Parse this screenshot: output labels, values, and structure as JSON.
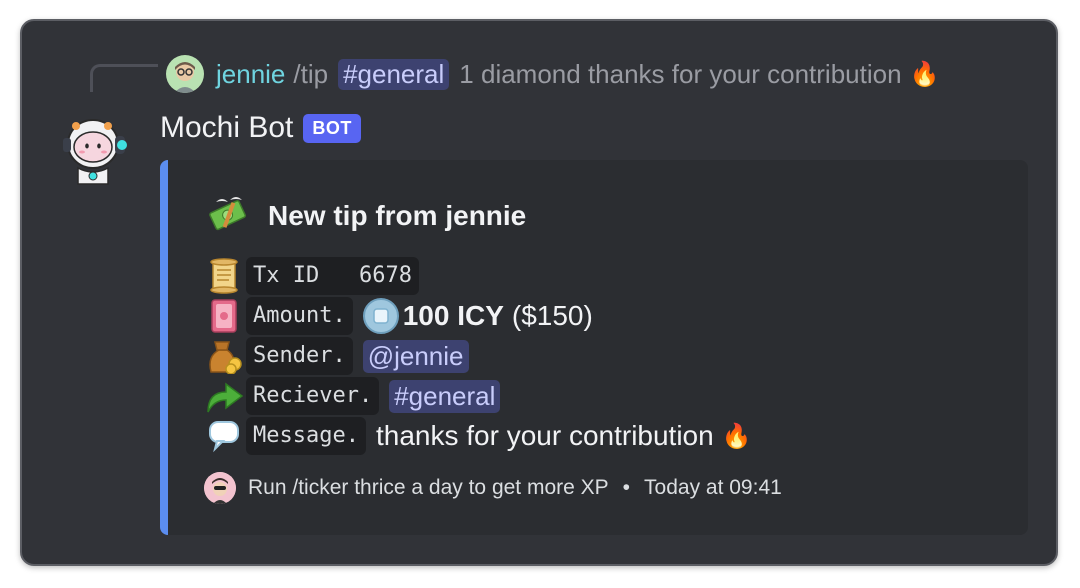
{
  "reply": {
    "username": "jennie",
    "command": "/tip",
    "channel": "#general",
    "text": "1 diamond thanks for your contribution",
    "emoji": "🔥"
  },
  "message": {
    "bot_name": "Mochi Bot",
    "bot_tag": "BOT"
  },
  "embed": {
    "accent_color": "#5b8def",
    "title_icon": "money-with-wings-icon",
    "title": "New tip from jennie",
    "fields": {
      "tx": {
        "icon": "scroll-icon",
        "label": "Tx ID   6678"
      },
      "amount": {
        "icon": "wallet-icon",
        "label": "Amount.",
        "value_bold": "100 ICY",
        "value_rest": "($150)"
      },
      "sender": {
        "icon": "money-bag-icon",
        "label": "Sender.",
        "value": "@jennie"
      },
      "receiver": {
        "icon": "arrow-right-icon",
        "label": "Reciever.",
        "value": "#general"
      },
      "message": {
        "icon": "speech-bubble-icon",
        "label": "Message.",
        "value": "thanks for your contribution",
        "emoji": "🔥"
      }
    },
    "footer": {
      "text": "Run /ticker thrice a day to get more XP",
      "separator": "•",
      "timestamp": "Today at 09:41"
    }
  }
}
